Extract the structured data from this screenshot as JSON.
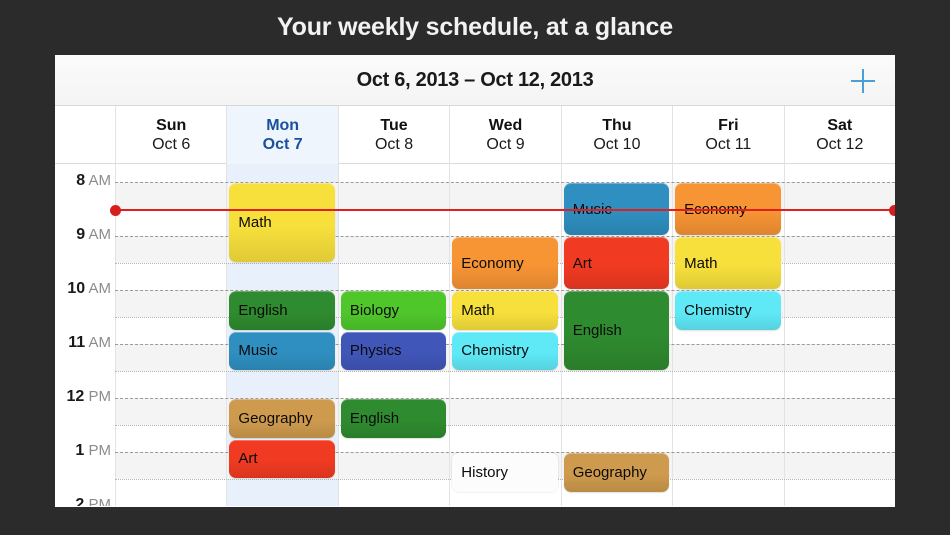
{
  "page": {
    "title": "Your weekly schedule, at a glance",
    "backdrop_color": "#2b2b2b"
  },
  "panel": {
    "date_range": "Oct 6, 2013 – Oct 12, 2013",
    "add_button_icon": "plus-icon",
    "accent_color": "#4a9fd8",
    "today_tint_color": "#e8f1fb",
    "today_text_color": "#1b4f9c"
  },
  "days": [
    {
      "dow": "Sun",
      "date": "Oct 6",
      "today": false
    },
    {
      "dow": "Mon",
      "date": "Oct 7",
      "today": true
    },
    {
      "dow": "Tue",
      "date": "Oct 8",
      "today": false
    },
    {
      "dow": "Wed",
      "date": "Oct 9",
      "today": false
    },
    {
      "dow": "Thu",
      "date": "Oct 10",
      "today": false
    },
    {
      "dow": "Fri",
      "date": "Oct 11",
      "today": false
    },
    {
      "dow": "Sat",
      "date": "Oct 12",
      "today": false
    }
  ],
  "time_axis": {
    "hours": [
      {
        "num": "8",
        "period": "AM"
      },
      {
        "num": "9",
        "period": "AM"
      },
      {
        "num": "10",
        "period": "AM"
      },
      {
        "num": "11",
        "period": "AM"
      },
      {
        "num": "12",
        "period": "PM"
      },
      {
        "num": "1",
        "period": "PM"
      },
      {
        "num": "2",
        "period": "PM"
      }
    ],
    "first_hour": 8,
    "last_hour_visible": 14,
    "last_hour_clipped": true
  },
  "now_indicator": {
    "time": "8:30 AM",
    "color": "#e02020",
    "has_end_dots": true
  },
  "events": [
    {
      "day": 1,
      "start": 8,
      "end": 9.5,
      "title": "Math",
      "color": "#f7e03c"
    },
    {
      "day": 1,
      "start": 10,
      "end": 10.75,
      "title": "English",
      "color": "#2f8b2f"
    },
    {
      "day": 1,
      "start": 10.75,
      "end": 11.5,
      "title": "Music",
      "color": "#2f8fc0"
    },
    {
      "day": 1,
      "start": 12,
      "end": 12.75,
      "title": "Geography",
      "color": "#ce9a4e"
    },
    {
      "day": 1,
      "start": 12.75,
      "end": 13.5,
      "title": "Art",
      "color": "#f03a22"
    },
    {
      "day": 2,
      "start": 10,
      "end": 10.75,
      "title": "Biology",
      "color": "#4fc72b"
    },
    {
      "day": 2,
      "start": 10.75,
      "end": 11.5,
      "title": "Physics",
      "color": "#4056b8"
    },
    {
      "day": 2,
      "start": 12,
      "end": 12.75,
      "title": "English",
      "color": "#2f8b2f"
    },
    {
      "day": 3,
      "start": 9,
      "end": 10,
      "title": "Economy",
      "color": "#f79434"
    },
    {
      "day": 3,
      "start": 10,
      "end": 10.75,
      "title": "Math",
      "color": "#f7e03c"
    },
    {
      "day": 3,
      "start": 10.75,
      "end": 11.5,
      "title": "Chemistry",
      "color": "#5fe9f7"
    },
    {
      "day": 3,
      "start": 13,
      "end": 13.75,
      "title": "History",
      "color": "#fcfcfc",
      "plain": true
    },
    {
      "day": 4,
      "start": 8,
      "end": 9,
      "title": "Music",
      "color": "#2f8fc0"
    },
    {
      "day": 4,
      "start": 9,
      "end": 10,
      "title": "Art",
      "color": "#f03a22"
    },
    {
      "day": 4,
      "start": 10,
      "end": 11.5,
      "title": "English",
      "color": "#2f8b2f"
    },
    {
      "day": 4,
      "start": 13,
      "end": 13.75,
      "title": "Geography",
      "color": "#ce9a4e"
    },
    {
      "day": 5,
      "start": 8,
      "end": 9,
      "title": "Economy",
      "color": "#f79434"
    },
    {
      "day": 5,
      "start": 9,
      "end": 10,
      "title": "Math",
      "color": "#f7e03c"
    },
    {
      "day": 5,
      "start": 10,
      "end": 10.75,
      "title": "Chemistry",
      "color": "#5fe9f7"
    }
  ]
}
